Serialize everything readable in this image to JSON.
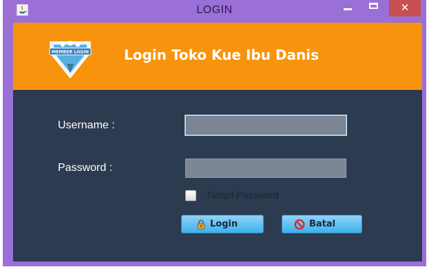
{
  "window": {
    "title": "LOGIN",
    "controls": {
      "minimize_icon": "minimize-icon",
      "maximize_icon": "maximize-icon",
      "close_icon": "close-icon",
      "close_glyph": "✕"
    }
  },
  "header": {
    "badge_text": "MEMBER LOGIN",
    "title": "Login Toko Kue Ibu Danis",
    "background_color": "#f7930d"
  },
  "form": {
    "username": {
      "label": "Username :",
      "value": ""
    },
    "password": {
      "label": "Password :",
      "value": ""
    },
    "show_password": {
      "label": "Tampil Password",
      "checked": false
    },
    "panel_color": "#2d3b50"
  },
  "buttons": {
    "login": {
      "label": "Login",
      "icon": "lock-icon"
    },
    "cancel": {
      "label": "Batal",
      "icon": "prohibited-icon"
    }
  }
}
